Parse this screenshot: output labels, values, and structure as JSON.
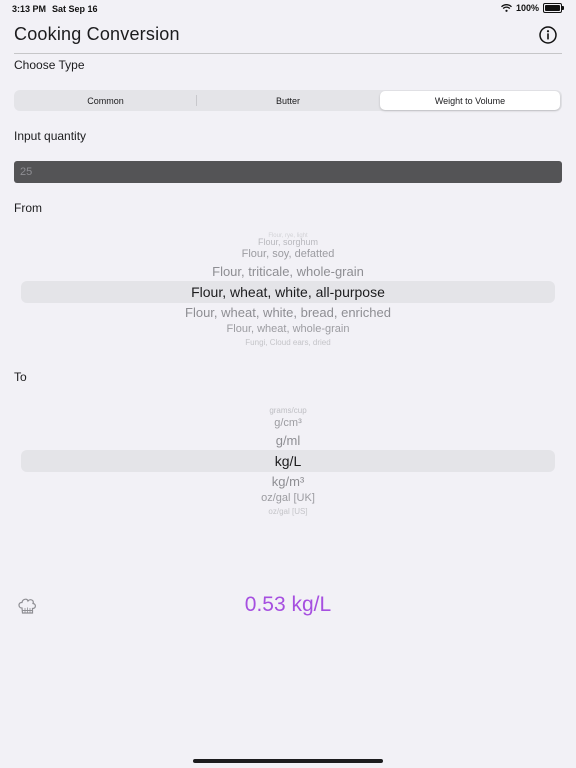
{
  "status_bar": {
    "time": "3:13 PM",
    "date": "Sat Sep 16",
    "battery": "100%"
  },
  "header": {
    "title": "Cooking Conversion",
    "info_icon": "info-circle-icon"
  },
  "type_section": {
    "label": "Choose Type",
    "segments": [
      "Common",
      "Butter",
      "Weight to Volume"
    ],
    "selected_index": 2
  },
  "quantity": {
    "label": "Input quantity",
    "placeholder": "25",
    "value": ""
  },
  "from_picker": {
    "label": "From",
    "items": [
      "Flour, rye, light",
      "Flour, sorghum",
      "Flour, soy, defatted",
      "Flour, triticale, whole-grain",
      "Flour, wheat, white, all-purpose",
      "Flour, wheat, white, bread, enriched",
      "Flour, wheat, whole-grain",
      "Fungi, Cloud ears, dried"
    ],
    "selected": "Flour, wheat, white, all-purpose"
  },
  "to_picker": {
    "label": "To",
    "items": [
      "grams/cup",
      "g/cm³",
      "g/ml",
      "kg/L",
      "kg/m³",
      "oz/gal [UK]",
      "oz/gal [US]"
    ],
    "selected": "kg/L"
  },
  "result": {
    "text": "0.53 kg/L",
    "color": "#a64fe0",
    "icon": "chef-hat-icon"
  }
}
